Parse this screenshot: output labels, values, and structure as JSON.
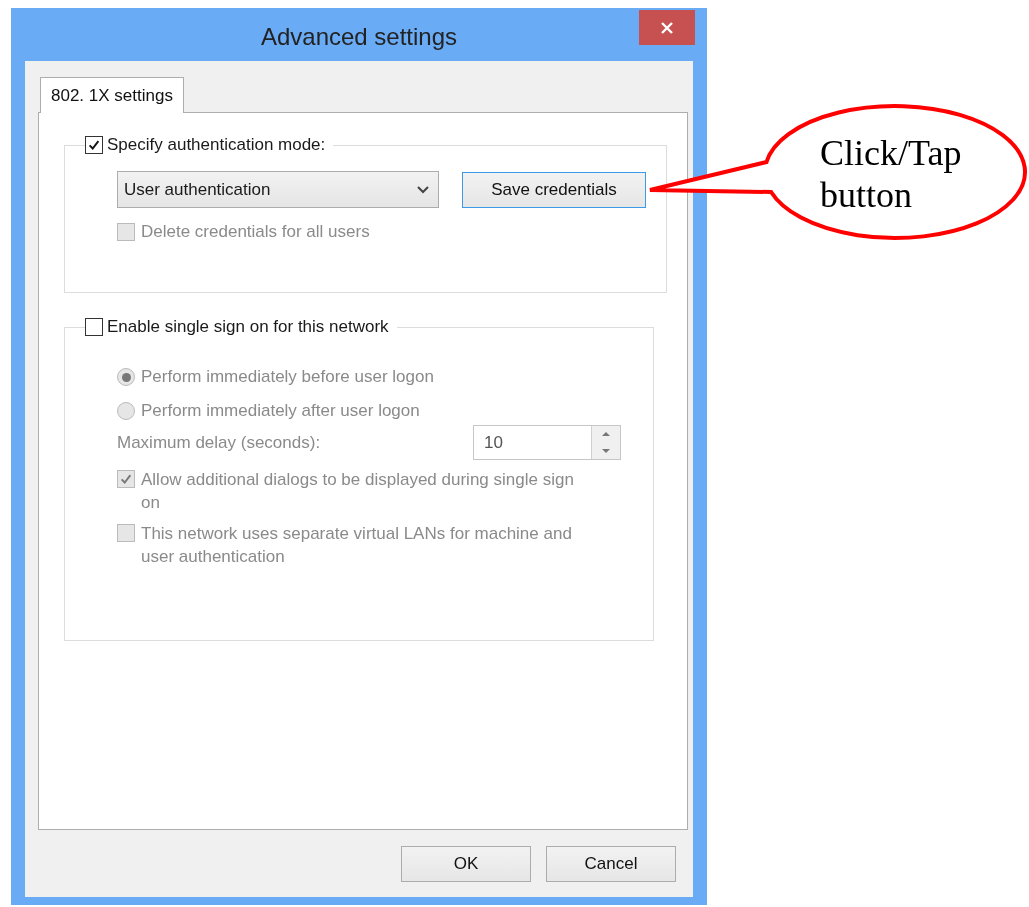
{
  "window": {
    "title": "Advanced settings"
  },
  "tabs": [
    {
      "label": "802. 1X settings",
      "selected": true
    }
  ],
  "authentication": {
    "label": "Specify authentication mode:",
    "checked": true,
    "mode": "User authentication",
    "save_button": "Save credentials",
    "delete_all": {
      "label": "Delete credentials for all users",
      "checked": false,
      "disabled": true
    }
  },
  "single_sign_on": {
    "label": "Enable single sign on for this network",
    "checked": false,
    "radios": [
      {
        "label": "Perform immediately before user logon",
        "selected": true,
        "disabled": true
      },
      {
        "label": "Perform immediately after user logon",
        "selected": false,
        "disabled": true
      }
    ],
    "delay": {
      "label": "Maximum delay (seconds):",
      "value": "10",
      "disabled": true
    },
    "checkboxes": [
      {
        "label": "Allow additional dialogs to be displayed during single sign on",
        "checked": true,
        "disabled": true
      },
      {
        "label": "This network uses separate virtual LANs for machine and user authentication",
        "checked": false,
        "disabled": true
      }
    ]
  },
  "buttons": [
    "OK",
    "Cancel"
  ],
  "callout": {
    "text": "Click/Tap button"
  }
}
